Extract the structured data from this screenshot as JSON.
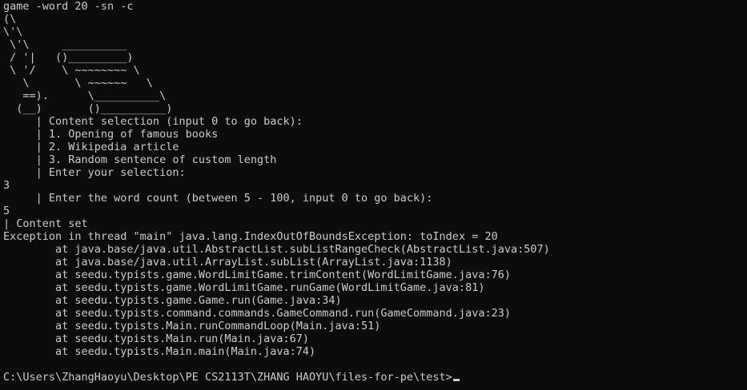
{
  "terminal": {
    "background": "#0c0c0c",
    "foreground": "#cccccc",
    "lines": [
      "game -word 20 -sn -c",
      "(\\",
      "\\'\\",
      " \\'\\     __________",
      " / '|   ()_________)",
      " \\ '/    \\ ~~~~~~~~ \\",
      "   \\       \\ ~~~~~~   \\",
      "   ==).      \\__________\\",
      "  (__)       ()__________)",
      "     | Content selection (input 0 to go back):",
      "     | 1. Opening of famous books",
      "     | 2. Wikipedia article",
      "     | 3. Random sentence of custom length",
      "     | Enter your selection:",
      "3",
      "     | Enter the word count (between 5 - 100, input 0 to go back):",
      "5",
      "| Content set",
      "Exception in thread \"main\" java.lang.IndexOutOfBoundsException: toIndex = 20",
      "        at java.base/java.util.AbstractList.subListRangeCheck(AbstractList.java:507)",
      "        at java.base/java.util.ArrayList.subList(ArrayList.java:1138)",
      "        at seedu.typists.game.WordLimitGame.trimContent(WordLimitGame.java:76)",
      "        at seedu.typists.game.WordLimitGame.runGame(WordLimitGame.java:81)",
      "        at seedu.typists.game.Game.run(Game.java:34)",
      "        at seedu.typists.command.commands.GameCommand.run(GameCommand.java:23)",
      "        at seedu.typists.Main.runCommandLoop(Main.java:51)",
      "        at seedu.typists.Main.run(Main.java:67)",
      "        at seedu.typists.Main.main(Main.java:74)",
      ""
    ],
    "prompt": "C:\\Users\\ZhangHaoyu\\Desktop\\PE CS2113T\\ZHANG HAOYU\\files-for-pe\\test>"
  }
}
